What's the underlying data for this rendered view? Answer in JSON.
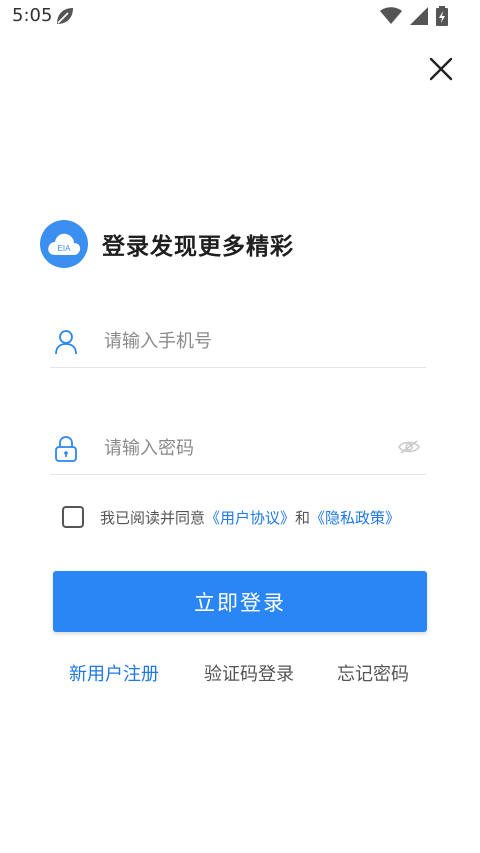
{
  "status_bar": {
    "time": "5:05",
    "icons": [
      "leaf-icon",
      "wifi-icon",
      "signal-icon",
      "battery-icon"
    ]
  },
  "header": {
    "close_icon": "close-icon"
  },
  "brand": {
    "logo_text": "EIA",
    "title": "登录发现更多精彩",
    "logo_color": "#3b8ff0"
  },
  "form": {
    "phone_placeholder": "请输入手机号",
    "password_placeholder": "请输入密码",
    "phone_icon": "user-icon",
    "password_icon": "lock-icon",
    "eye_icon": "eye-icon"
  },
  "agreement": {
    "prefix": "我已阅读并同意",
    "user_agreement": "《用户协议》",
    "conjunction": "和",
    "privacy_policy": "《隐私政策》",
    "checked": false
  },
  "actions": {
    "login_label": "立即登录",
    "register_label": "新用户注册",
    "code_login_label": "验证码登录",
    "forgot_label": "忘记密码"
  },
  "colors": {
    "accent": "#2b86f5",
    "link": "#1e78e8"
  }
}
